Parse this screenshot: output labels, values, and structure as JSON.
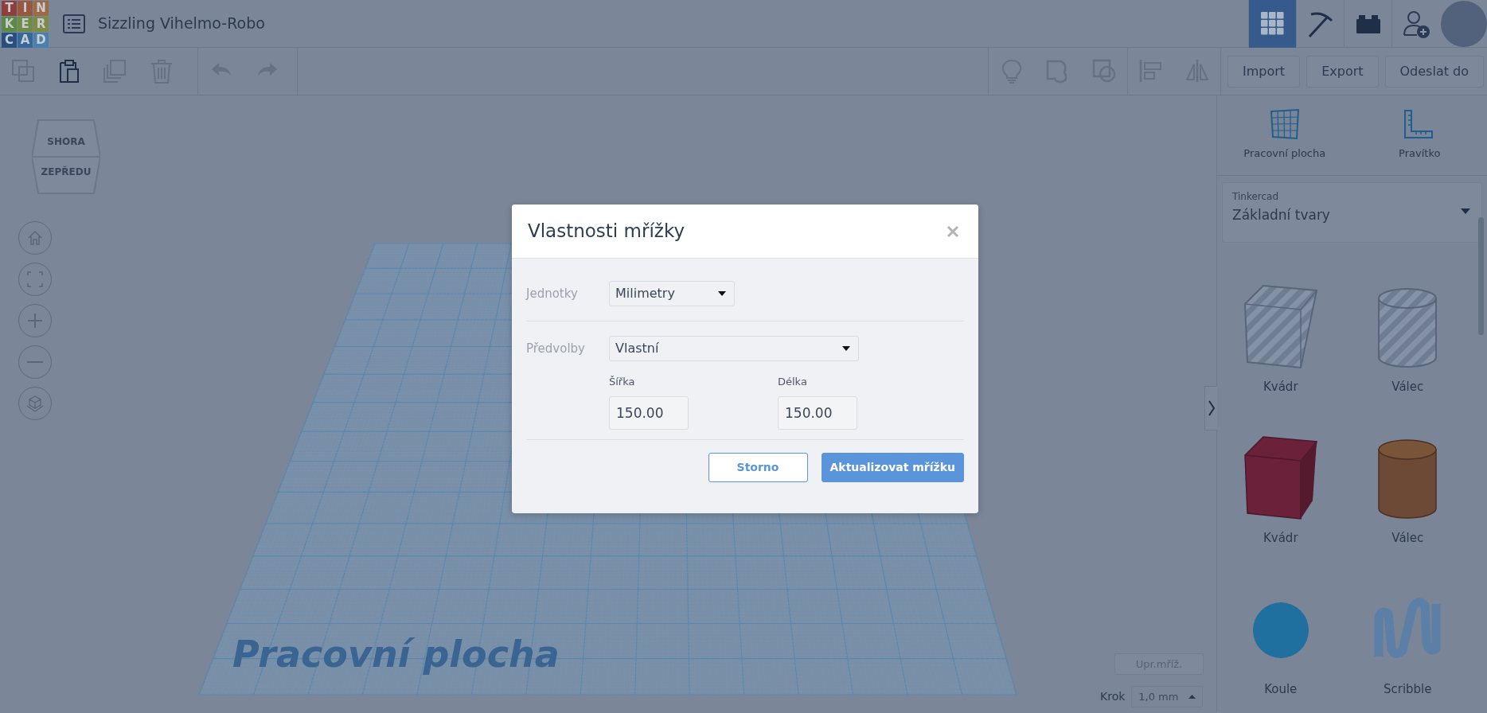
{
  "header": {
    "logo_letters": [
      "T",
      "I",
      "N",
      "K",
      "E",
      "R",
      "C",
      "A",
      "D"
    ],
    "design_title": "Sizzling Vihelmo-Robo",
    "views": [
      {
        "kind": "grid",
        "selected": true
      },
      {
        "kind": "pickaxe",
        "selected": false
      },
      {
        "kind": "bricks",
        "selected": false
      }
    ]
  },
  "toolbar": {
    "edit_actions": [
      {
        "kind": "copy",
        "disabled": true
      },
      {
        "kind": "paste",
        "disabled": false
      },
      {
        "kind": "duplicate",
        "disabled": true
      },
      {
        "kind": "delete",
        "disabled": true
      }
    ],
    "history_actions": [
      {
        "kind": "undo",
        "disabled": true
      },
      {
        "kind": "redo",
        "disabled": true
      }
    ],
    "shape_actions": [
      {
        "kind": "bulb",
        "disabled": true
      },
      {
        "kind": "group",
        "disabled": true
      },
      {
        "kind": "ungroup",
        "disabled": true
      },
      {
        "kind": "align",
        "disabled": true
      },
      {
        "kind": "mirror",
        "disabled": true
      }
    ],
    "buttons": [
      "Import",
      "Export",
      "Odeslat do"
    ]
  },
  "view_cube": {
    "top": "SHORA",
    "front": "ZEPŘEDU"
  },
  "workplane": {
    "label": "Pracovní plocha"
  },
  "grid_controls": {
    "edit_grid": "Upr.mříž.",
    "snap_label": "Krok",
    "snap_value": "1,0 mm"
  },
  "panel": {
    "tools": [
      {
        "kind": "workplane",
        "label": "Pracovní plocha"
      },
      {
        "kind": "ruler",
        "label": "Pravítko"
      }
    ],
    "library": {
      "source": "Tinkercad",
      "value": "Základní tvary"
    },
    "shapes": [
      {
        "kind": "box-hole",
        "label": "Kvádr"
      },
      {
        "kind": "cylinder-hole",
        "label": "Válec"
      },
      {
        "kind": "box",
        "label": "Kvádr",
        "color": "#6b2139"
      },
      {
        "kind": "cylinder",
        "label": "Válec",
        "color": "#6c4a35"
      },
      {
        "kind": "sphere",
        "label": "Koule",
        "color": "#1f6f9f"
      },
      {
        "kind": "scribble",
        "label": "Scribble",
        "color": "#5b7fa6"
      }
    ]
  },
  "dialog": {
    "title": "Vlastnosti mřížky",
    "units": {
      "label": "Jednotky",
      "value": "Milimetry"
    },
    "presets": {
      "label": "Předvolby",
      "value": "Vlastní"
    },
    "width": {
      "label": "Šířka",
      "value": "150.00"
    },
    "length": {
      "label": "Délka",
      "value": "150.00"
    },
    "buttons": [
      {
        "kind": "secondary",
        "label": "Storno"
      },
      {
        "kind": "primary",
        "label": "Aktualizovat mřížku"
      }
    ]
  }
}
